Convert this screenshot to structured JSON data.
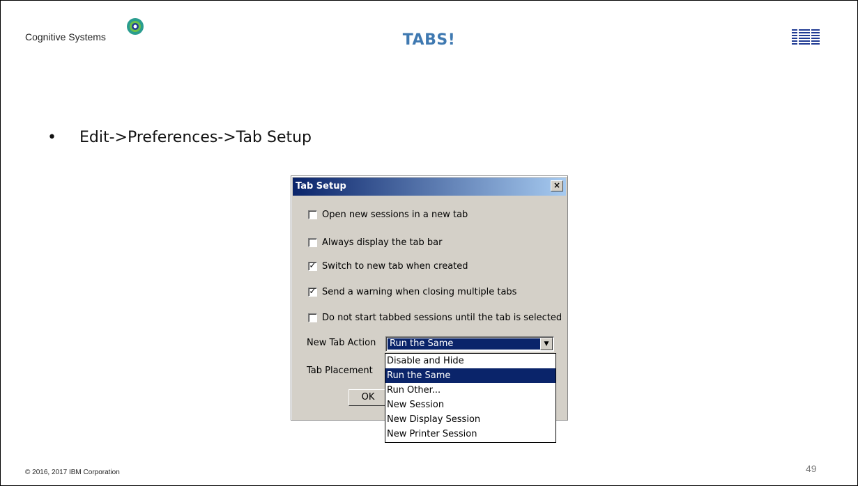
{
  "slide": {
    "company": "Cognitive Systems",
    "title": "TABS!",
    "brand": "IBM",
    "bullet_marker": "•",
    "bullet": "Edit->Preferences->Tab Setup",
    "footer": "© 2016, 2017 IBM Corporation",
    "page_number": "49",
    "colors": {
      "title": "#3f79b1",
      "ibm_logo": "#1f3a93",
      "logo_teal": "#2a9d8f"
    }
  },
  "dialog": {
    "title": "Tab Setup",
    "close_label": "×",
    "options": [
      {
        "label": "Open new sessions in a new tab",
        "checked": false
      },
      {
        "label": "Always display the tab bar",
        "checked": false
      },
      {
        "label": "Switch to new tab when created",
        "checked": true
      },
      {
        "label": "Send a warning when closing multiple tabs",
        "checked": true
      },
      {
        "label": "Do not start tabbed sessions until the tab is selected",
        "checked": false
      }
    ],
    "new_tab_action_label": "New Tab Action",
    "new_tab_action_value": "Run the Same",
    "tab_placement_label": "Tab Placement",
    "ok_label": "OK",
    "dropdown_arrow": "▼",
    "dropdown_options": [
      "Disable and Hide",
      "Run the Same",
      "Run Other...",
      "New Session",
      "New Display Session",
      "New Printer Session"
    ],
    "dropdown_selected": "Run the Same",
    "colors": {
      "titlebar_start": "#0a246a",
      "titlebar_end": "#a6caf0",
      "face": "#d4d0c8",
      "highlight": "#0a246a"
    }
  }
}
